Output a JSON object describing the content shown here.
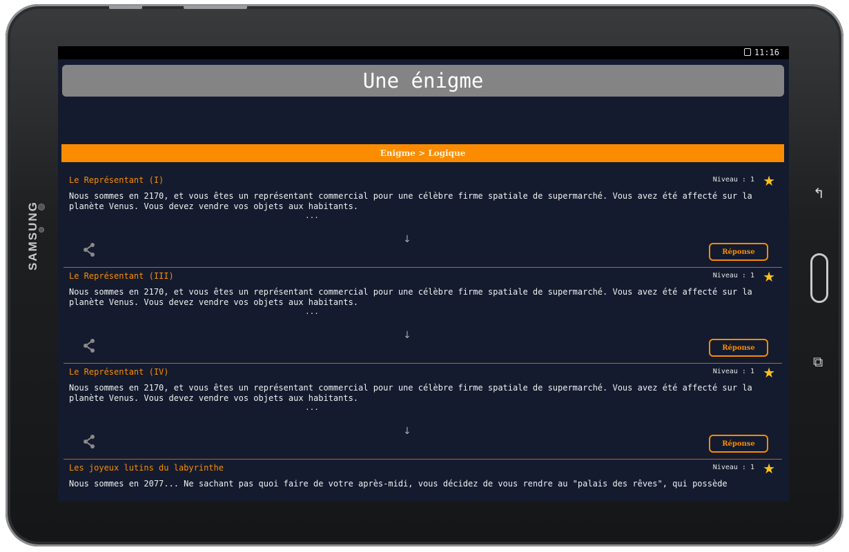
{
  "device": {
    "brand": "SAMSUNG"
  },
  "status": {
    "time": "11:16"
  },
  "app": {
    "title": "Une énigme",
    "category": "Enigme > Logique"
  },
  "colors": {
    "accent": "#fb8c00",
    "background": "#141b2e",
    "titlebar": "#848484",
    "star": "#f9c01d"
  },
  "cards": [
    {
      "title": "Le Représentant (I)",
      "level": "Niveau : 1",
      "text": "Nous sommes en 2170, et vous êtes un représentant commercial pour une célèbre firme spatiale de supermarché. Vous avez été affecté sur la planète Venus. Vous devez vendre vos objets aux habitants.",
      "ellipsis": "...",
      "arrow": "↓",
      "answer": "Réponse"
    },
    {
      "title": "Le Représentant (III)",
      "level": "Niveau : 1",
      "text": "Nous sommes en 2170, et vous êtes un représentant commercial pour une célèbre firme spatiale de supermarché. Vous avez été affecté sur la planète Venus. Vous devez vendre vos objets aux habitants.",
      "ellipsis": "...",
      "arrow": "↓",
      "answer": "Réponse"
    },
    {
      "title": "Le Représentant (IV)",
      "level": "Niveau : 1",
      "text": "Nous sommes en 2170, et vous êtes un représentant commercial pour une célèbre firme spatiale de supermarché. Vous avez été affecté sur la planète Venus. Vous devez vendre vos objets aux habitants.",
      "ellipsis": "...",
      "arrow": "↓",
      "answer": "Réponse"
    },
    {
      "title": "Les joyeux lutins du labyrinthe",
      "level": "Niveau : 1",
      "text": "Nous sommes en 2077... Ne sachant pas quoi faire de votre après-midi, vous décidez de vous rendre au \"palais des rêves\", qui possède"
    }
  ],
  "icons": {
    "share": "share-icon",
    "star": "star-icon",
    "back": "back-icon",
    "recents": "recents-icon",
    "lock": "lock-icon"
  }
}
